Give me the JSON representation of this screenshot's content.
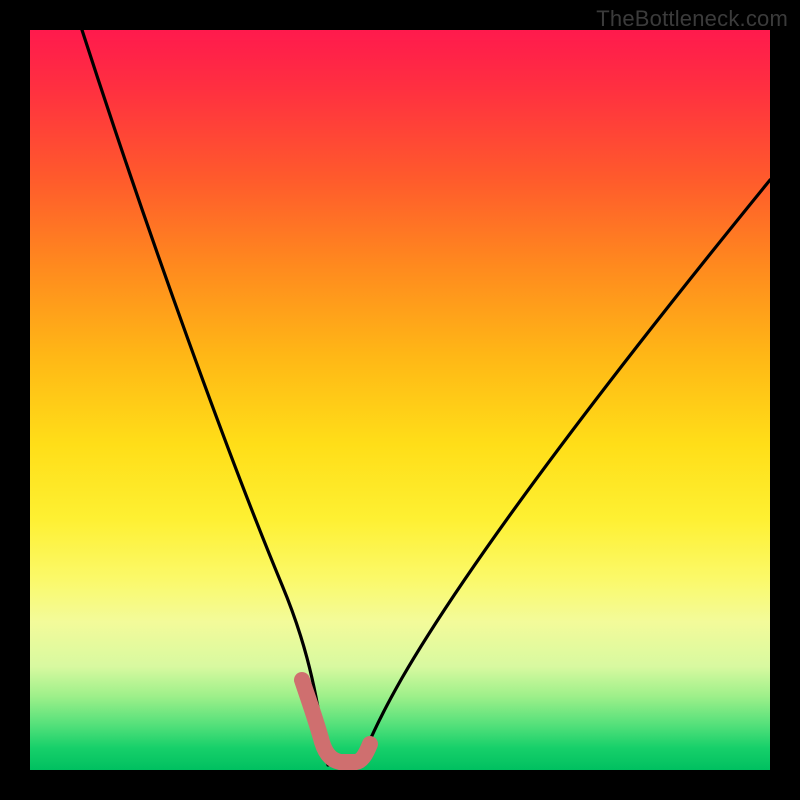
{
  "watermark": {
    "text": "TheBottleneck.com"
  },
  "chart_data": {
    "type": "line",
    "title": "",
    "xlabel": "",
    "ylabel": "",
    "xlim": [
      0,
      100
    ],
    "ylim": [
      0,
      100
    ],
    "grid": false,
    "legend": false,
    "series": [
      {
        "name": "left-branch",
        "x": [
          7,
          10,
          13,
          16,
          19,
          22,
          25,
          28,
          30,
          32,
          34,
          35.5,
          37,
          38,
          39,
          39.7
        ],
        "y": [
          100,
          92,
          84,
          76,
          68,
          59,
          50,
          41,
          34,
          27,
          20,
          14,
          9,
          5.5,
          3,
          1.5
        ]
      },
      {
        "name": "right-branch",
        "x": [
          44.5,
          46,
          48,
          51,
          55,
          60,
          66,
          73,
          81,
          90,
          100
        ],
        "y": [
          1.5,
          3.5,
          7,
          12,
          19,
          27,
          36,
          46,
          57,
          68,
          80
        ]
      },
      {
        "name": "floor-marker-left",
        "color": "#d06a6a",
        "x": [
          36.8,
          37.2,
          37.8,
          38.3,
          38.7,
          39.1,
          39.5
        ],
        "y": [
          11.5,
          9.8,
          8.0,
          6.4,
          5.0,
          3.8,
          2.8
        ]
      },
      {
        "name": "floor-marker-bottom",
        "color": "#d06a6a",
        "x": [
          39.5,
          40.5,
          41.5,
          42.5,
          43.5,
          44.3
        ],
        "y": [
          1.8,
          1.5,
          1.4,
          1.4,
          1.5,
          1.8
        ]
      },
      {
        "name": "floor-marker-right",
        "color": "#d06a6a",
        "x": [
          44.3,
          44.9,
          45.4,
          45.8
        ],
        "y": [
          1.8,
          2.8,
          3.8,
          4.8
        ]
      }
    ],
    "gradient_stops": [
      {
        "pos": 0.0,
        "color": "#ff1a4d"
      },
      {
        "pos": 0.5,
        "color": "#ffde18"
      },
      {
        "pos": 1.0,
        "color": "#00c060"
      }
    ],
    "notch_x": 42,
    "notch_y": 1.4
  }
}
